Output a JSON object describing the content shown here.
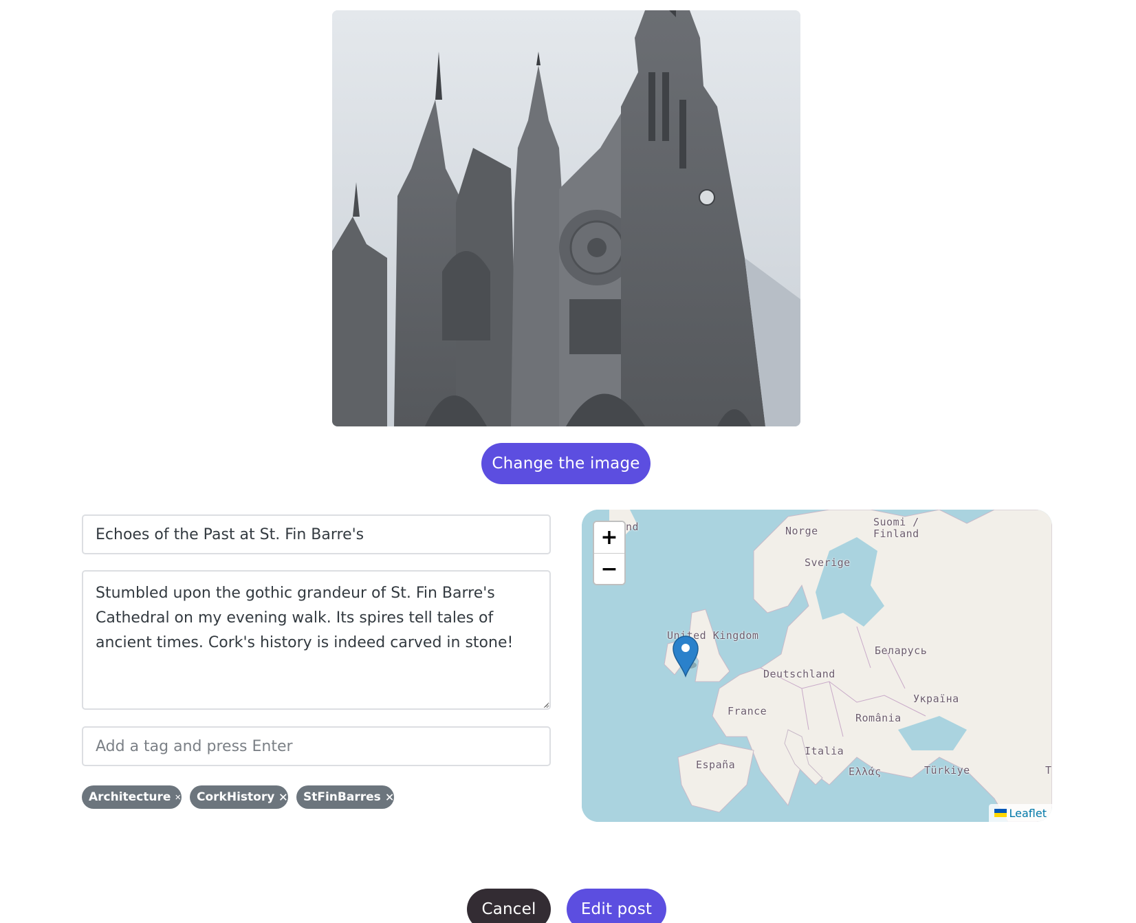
{
  "photo": {
    "alt": "Gothic cathedral with tall spires under an overcast sky"
  },
  "actions": {
    "change_image_label": "Change the image",
    "cancel_label": "Cancel",
    "submit_label": "Edit post"
  },
  "form": {
    "title_value": "Echoes of the Past at St. Fin Barre's",
    "description_value": "Stumbled upon the gothic grandeur of St. Fin Barre's Cathedral on my evening walk. Its spires tell tales of ancient times. Cork's history is indeed carved in stone!",
    "tag_placeholder": "Add a tag and press Enter",
    "tags": [
      "Architecture",
      "CorkHistory",
      "StFinBarres"
    ]
  },
  "map": {
    "zoom_in_label": "+",
    "zoom_out_label": "−",
    "labels": {
      "iceland_partial": "nd",
      "norway": "Norge",
      "finland": "Suomi / Finland",
      "sweden": "Sverige",
      "uk": "United Kingdom",
      "belarus": "Беларусь",
      "germany": "Deutschland",
      "ukraine": "Україна",
      "france": "France",
      "romania": "România",
      "italy": "Italia",
      "spain": "España",
      "greece": "Ελλάς",
      "turkey": "Türkiye",
      "edge_partial": "T"
    },
    "attribution": "Leaflet",
    "marker_icon": "map-pin-icon"
  },
  "colors": {
    "primary": "#5c4ee0",
    "dark": "#332c33",
    "tag_bg": "#6c757d",
    "water": "#aad3df",
    "land": "#f2efe9"
  }
}
